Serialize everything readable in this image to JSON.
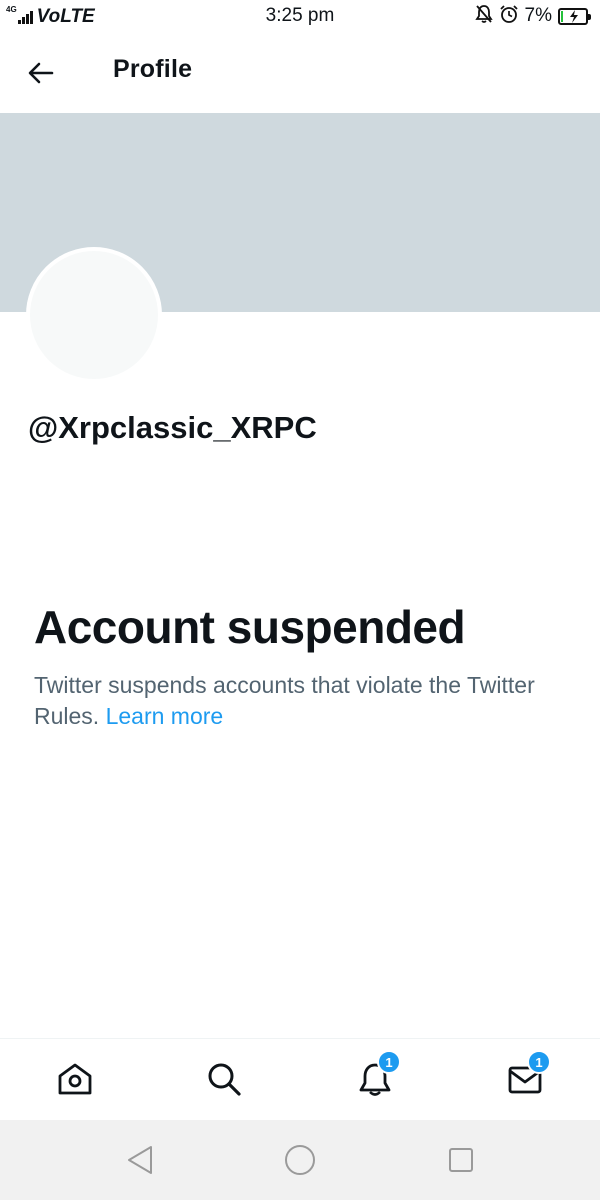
{
  "status_bar": {
    "network": "4G",
    "carrier": "VoLTE",
    "time": "3:25 pm",
    "battery_percent": "7%",
    "battery_level": 0.07,
    "icons": [
      "mute-icon",
      "alarm-icon",
      "battery-charging-icon"
    ]
  },
  "header": {
    "title": "Profile",
    "back_icon": "arrow-left-icon"
  },
  "profile": {
    "handle": "@Xrpclassic_XRPC",
    "banner_color": "#cfd9de",
    "avatar_color": "#f7f9f9"
  },
  "suspension": {
    "title": "Account suspended",
    "description": "Twitter suspends accounts that violate the Twitter Rules.",
    "link": "Learn more"
  },
  "bottom_nav": {
    "items": [
      {
        "name": "home",
        "icon": "home-icon"
      },
      {
        "name": "search",
        "icon": "search-icon"
      },
      {
        "name": "notifications",
        "icon": "bell-icon",
        "badge": "1"
      },
      {
        "name": "messages",
        "icon": "envelope-icon",
        "badge": "1"
      }
    ]
  },
  "android_nav": {
    "items": [
      "back-triangle-icon",
      "home-circle-icon",
      "recents-square-icon"
    ]
  },
  "colors": {
    "accent": "#1d9bf0",
    "text_primary": "#0f1419",
    "text_secondary": "#536471"
  }
}
